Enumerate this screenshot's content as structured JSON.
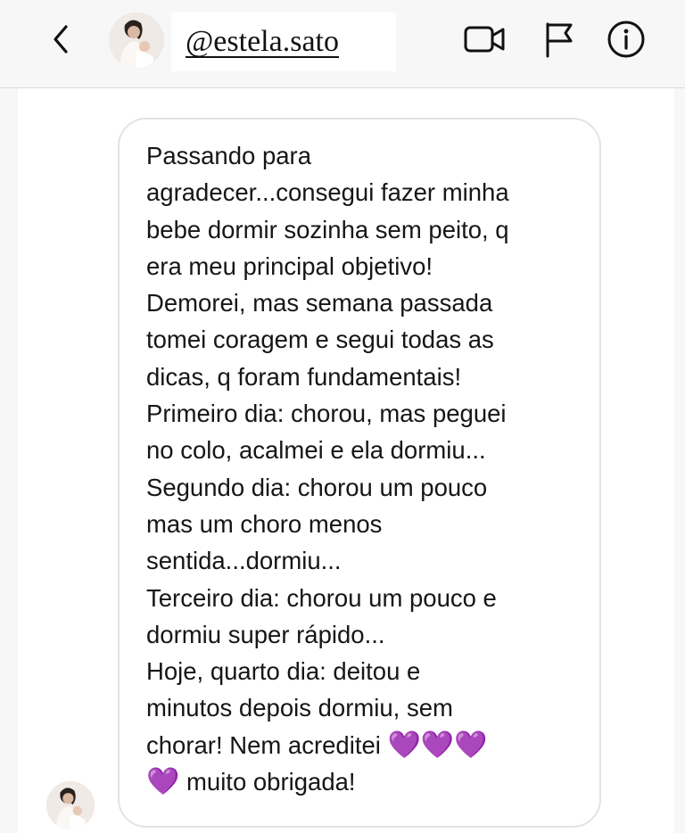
{
  "header": {
    "username": "@estela.sato",
    "back_icon": "chevron-left-icon",
    "video_icon": "video-camera-icon",
    "flag_icon": "flag-icon",
    "info_icon": "info-circle-icon"
  },
  "message": {
    "paragraphs": [
      "Passando para\nagradecer...consegui fazer minha\nbebe dormir sozinha sem peito, q\nera meu principal objetivo!",
      "Demorei, mas semana passada\ntomei coragem e segui todas as\ndicas, q foram fundamentais!",
      "Primeiro dia: chorou, mas peguei\nno colo, acalmei e ela dormiu...",
      "Segundo dia: chorou um pouco\nmas um choro menos\nsentida...dormiu...",
      "Terceiro dia: chorou um pouco e\ndormiu super rápido...",
      "Hoje, quarto dia: deitou e\nminutos depois dormiu, sem\nchorar! Nem acreditei "
    ],
    "hearts_line": "💜💜💜",
    "final_heart": "💜",
    "final_text": " muito obrigada!"
  },
  "colors": {
    "accent_heart": "#9b2fe0",
    "header_bg": "#f7f7f7",
    "bubble_border": "#e3e3e3"
  }
}
